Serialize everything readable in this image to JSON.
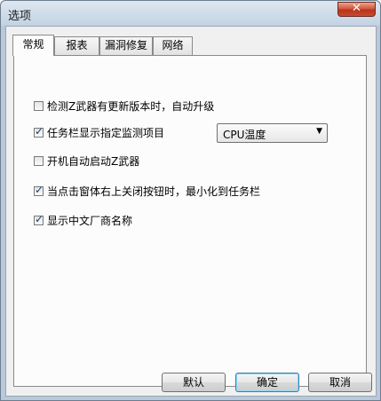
{
  "window": {
    "title": "选项"
  },
  "tabs": [
    {
      "label": "常规"
    },
    {
      "label": "报表"
    },
    {
      "label": "漏洞修复"
    },
    {
      "label": "网络"
    }
  ],
  "options": {
    "auto_upgrade": {
      "label": "检测Z武器有更新版本时，自动升级",
      "checked": false
    },
    "taskbar_monitor": {
      "label": "任务栏显示指定监测项目",
      "checked": true
    },
    "autostart": {
      "label": "开机自动启动Z武器",
      "checked": false
    },
    "minimize_on_close": {
      "label": "当点击窗体右上关闭按钮时，最小化到任务栏",
      "checked": true
    },
    "chinese_vendor_name": {
      "label": "显示中文厂商名称",
      "checked": true
    }
  },
  "monitor_select": {
    "value": "CPU温度"
  },
  "buttons": {
    "default": "默认",
    "ok": "确定",
    "cancel": "取消"
  },
  "icons": {
    "close": "close-icon",
    "dropdown": "chevron-down-icon",
    "check": "checkmark-icon"
  }
}
